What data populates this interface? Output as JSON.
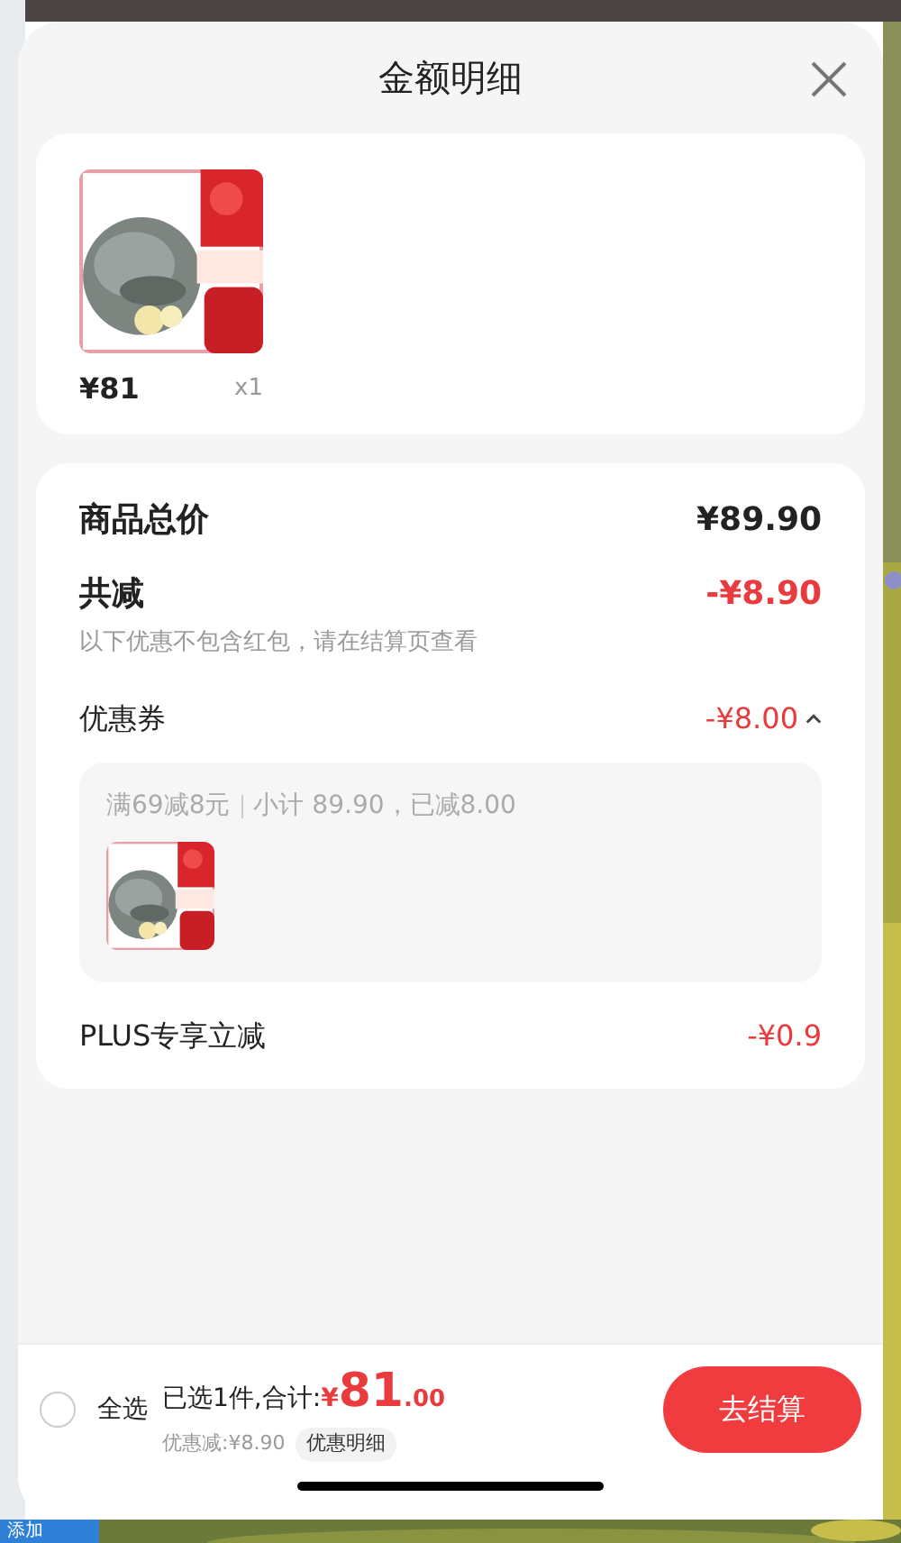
{
  "title": "金额明细",
  "product": {
    "price": "¥81",
    "quantity": "x1"
  },
  "summary": {
    "total_label": "商品总价",
    "total": "¥89.90",
    "discount_label": "共减",
    "discount": "-¥8.90",
    "note": "以下优惠不包含红包，请在结算页查看"
  },
  "coupon": {
    "label": "优惠券",
    "amount": "-¥8.00",
    "expanded": true,
    "rule": "满69减8元",
    "detail": "小计 89.90，已减8.00"
  },
  "plus": {
    "label": "PLUS专享立减",
    "amount": "-¥0.9"
  },
  "footer": {
    "select_all": {
      "label": "全选",
      "checked": false
    },
    "selected_text": "已选1件,合计:",
    "currency": "¥",
    "total_integer": "81",
    "total_decimal": ".00",
    "discount_text": "优惠减:¥8.90",
    "details_button": "优惠明细",
    "checkout_button": "去结算"
  },
  "background": {
    "add_button": "添加"
  }
}
